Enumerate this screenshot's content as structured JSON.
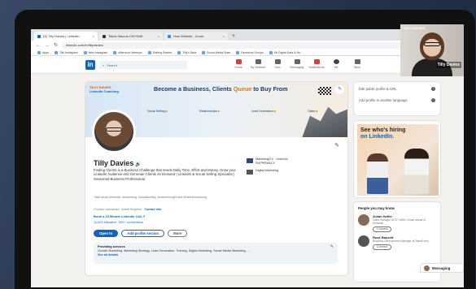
{
  "browser": {
    "tabs": [
      {
        "label": "(8) Tilly Davies | LinkedIn",
        "active": true
      },
      {
        "label": "Tiktok Macros Ctrl+Shift",
        "active": false
      },
      {
        "label": "How Website - Zoom",
        "active": false
      }
    ],
    "url": "linkedin.com/in/tillydavies/",
    "bookmarks": [
      "Apps",
      "Tilly Instagram",
      "New Instagram",
      "Afternoon Meetups",
      "Getting Started",
      "Tilly's Data",
      "Social Media Stats",
      "Facebook Groups",
      "Mr Digital Data & Ne..."
    ]
  },
  "nav": {
    "logo": "in",
    "search_placeholder": "Search",
    "items": [
      "Home",
      "My Network",
      "Jobs",
      "Messaging",
      "Notifications",
      "Me",
      "Work"
    ]
  },
  "banner": {
    "brand_line1": "TILLY DAVIES",
    "brand_line2": "LinkedIn Coaching",
    "headline_pre": "Become a Business, Clients ",
    "headline_hl": "Queue",
    "headline_post": " to Buy From",
    "steps": [
      "Social Selling",
      "Relationships",
      "Lead Generation",
      "Sales"
    ]
  },
  "profile": {
    "name": "Tilly Davies",
    "pronoun_icon": "speaker-icon",
    "bio": "Finding Clients is a Business Challenge that needs Daily Time, Effort and Money. Grow your LinkedIn Audience and Generate Clients on Demand | LinkedIn & Social Selling Specialist | Seasoned Business Professional",
    "talks": "Talks about #linkedin, #marketing, #socialselling, #leadsthrought and #linkedincoaching",
    "location": "Chorley, Lancashire, United Kingdom",
    "contact": "Contact info",
    "booking": "Book a 15 Minute LinkedIn Call",
    "followers_connections": "14,403 followers · 500+ connections",
    "btn_open": "Open to",
    "btn_add": "Add profile section",
    "btn_more": "More",
    "experience": [
      {
        "company": "MarketingCX · LinkedIn",
        "detail": "SUPREMACY"
      },
      {
        "company": "Digital Marketing",
        "detail": ""
      }
    ],
    "services_title": "Providing services",
    "services_list": "Growth Marketing, Marketing Strategy, Lead Generation, Training, Digital Marketing, Social Media Marketing, ...",
    "services_link": "See all details"
  },
  "right": {
    "edit_public": "Edit public profile & URL",
    "add_language": "Add profile in another language",
    "ad_line1": "See who's hiring",
    "ad_line2": "on LinkedIn.",
    "pymk_title": "People you may know",
    "people": [
      {
        "name": "Julian Hefler",
        "desc": "Sales Manager at CF Hefler Chase ahead of Softskills",
        "btn": "Connect"
      },
      {
        "name": "Ross Bassett",
        "desc": "Business Development Manager at SalesForce",
        "btn": "Connect"
      }
    ]
  },
  "messaging": "Messaging",
  "zoom_watermark": "zoom",
  "webcam": {
    "label": "TILLY DAVIES",
    "name": "Tilly Davies"
  },
  "colors": {
    "brand": "#0a66c2",
    "accent": "#e07a00",
    "background": "#f3f2ef"
  }
}
